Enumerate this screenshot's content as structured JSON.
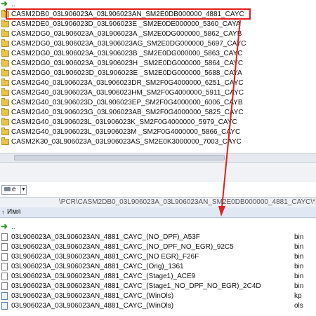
{
  "top_pane": {
    "up_label": "..",
    "folders": [
      "CASM2DB0_03L906023A_03L906023AN_SM2E0DB000000_4881_CAYC",
      "CASM2DE0_03L906023D_03L906023E _SM2E0DE000000_5360_CAYA",
      "CASM2DG0_03L906023A_03L906023A _SM2E0DG000000_5862_CAYB",
      "CASM2DG0_03L906023A_03L906023AG_SM2E0DG000000_5697_CAYC",
      "CASM2DG0_03L906023A_03L906023B _SM2E0DG000000_5863_CAYC",
      "CASM2DG0_03L906023A_03L906023H _SM2E0DG000000_5864_CAYC",
      "CASM2DG0_03L906023D_03L906023E _SM2E0DG000000_5688_CAYA",
      "CASM2G40_03L906023A_03L906023DR_SM2F0G4000000_6251_CAYC",
      "CASM2G40_03L906023A_03L906023HM_SM2F0G4000000_5911_CAYC",
      "CASM2G40_03L906023D_03L906023EP_SM2F0G4000000_6006_CAYB",
      "CASM2G40_03L906023G_03L906023AB_SM2F0G4000000_5825_CAYC",
      "CASM2G40_03L906023L_03L906023K_SM2F0G4000000_5979_CAYC",
      "CASM2G40_03L906023L_03L906023M _SM2F0G4000000_5866_CAYC",
      "CASM2K30_03L906023A_03L906023AS_SM2E0K3000000_7003_CAYC"
    ]
  },
  "drive": {
    "label": "e"
  },
  "path_bar": {
    "text": "\\PCR\\CASM2DB0_03L906023A_03L906023AN_SM2E0DB000000_4881_CAYC\\*.*"
  },
  "column_header": {
    "sort_indicator": "↑",
    "name": "Имя"
  },
  "bottom_list": {
    "up_label": "..",
    "files": [
      {
        "name": "03L906023A_03L906023AN_4881_CAYC_(NO_DPF)_A53F",
        "ext": "bin",
        "icon": "file-icon"
      },
      {
        "name": "03L906023A_03L906023AN_4881_CAYC_(NO_DPF_NO_EGR)_92C5",
        "ext": "bin",
        "icon": "file-icon"
      },
      {
        "name": "03L906023A_03L906023AN_4881_CAYC_(NO EGR)_F26F",
        "ext": "bin",
        "icon": "file-icon"
      },
      {
        "name": "03L906023A_03L906023AN_4881_CAYC_(Orig)_1361",
        "ext": "bin",
        "icon": "file-icon"
      },
      {
        "name": "03L906023A_03L906023AN_4881_CAYC_(Stage1)_ACE9",
        "ext": "bin",
        "icon": "file-icon"
      },
      {
        "name": "03L906023A_03L906023AN_4881_CAYC_(Stage1_NO_DPF_NO_EGR)_2C4D",
        "ext": "bin",
        "icon": "file-icon"
      },
      {
        "name": "03L906023A_03L906023AN_4881_CAYC_(WinOls)",
        "ext": "kp",
        "icon": "kp-file-icon"
      },
      {
        "name": "03L906023A_03L906023AN_4881_CAYC_(WinOls)",
        "ext": "ols",
        "icon": "ols-file-icon"
      }
    ]
  },
  "annotation": {
    "color": "#e02020"
  }
}
